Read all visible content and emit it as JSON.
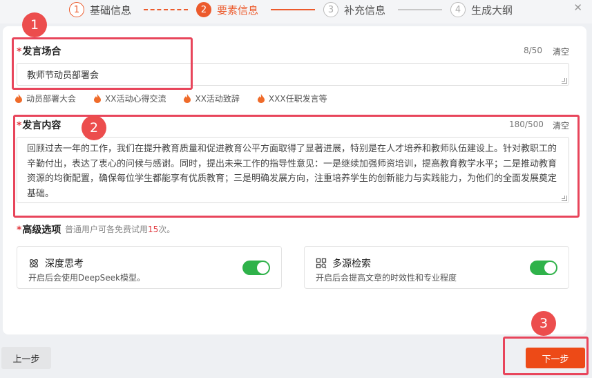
{
  "stepper": {
    "steps": [
      {
        "num": "1",
        "label": "基础信息",
        "state": "done"
      },
      {
        "num": "2",
        "label": "要素信息",
        "state": "active"
      },
      {
        "num": "3",
        "label": "补充信息",
        "state": "pending"
      },
      {
        "num": "4",
        "label": "生成大纲",
        "state": "pending"
      }
    ],
    "close": "✕"
  },
  "occasion": {
    "required_mark": "*",
    "label": "发言场合",
    "counter": "8/50",
    "clear": "清空",
    "value": "教师节动员部署会",
    "hints": [
      "动员部署大会",
      "XX活动心得交流",
      "XX活动致辞",
      "XXX任职发言等"
    ]
  },
  "content": {
    "required_mark": "*",
    "label": "发言内容",
    "counter": "180/500",
    "clear": "清空",
    "value": "回顾过去一年的工作，我们在提升教育质量和促进教育公平方面取得了显著进展，特别是在人才培养和教师队伍建设上。针对教职工的辛勤付出，表达了衷心的问候与感谢。同时，提出未来工作的指导性意见：一是继续加强师资培训，提高教育教学水平；二是推动教育资源的均衡配置，确保每位学生都能享有优质教育；三是明确发展方向，注重培养学生的创新能力与实践能力，为他们的全面发展奠定基础。"
  },
  "advanced": {
    "required_mark": "*",
    "label": "高级选项",
    "note_prefix": "普通用户可各免费试用",
    "note_num": "15",
    "note_suffix": "次。",
    "options": [
      {
        "title": "深度思考",
        "desc": "开启后会使用DeepSeek模型。",
        "on": true
      },
      {
        "title": "多源检索",
        "desc": "开启后会提高文章的时效性和专业程度",
        "on": true
      }
    ]
  },
  "buttons": {
    "prev": "上一步",
    "next": "下一步"
  },
  "annotations": [
    "1",
    "2",
    "3"
  ],
  "colors": {
    "accent": "#ec5a2c",
    "annotation": "#e8455b",
    "toggle_on": "#2fb24a"
  }
}
